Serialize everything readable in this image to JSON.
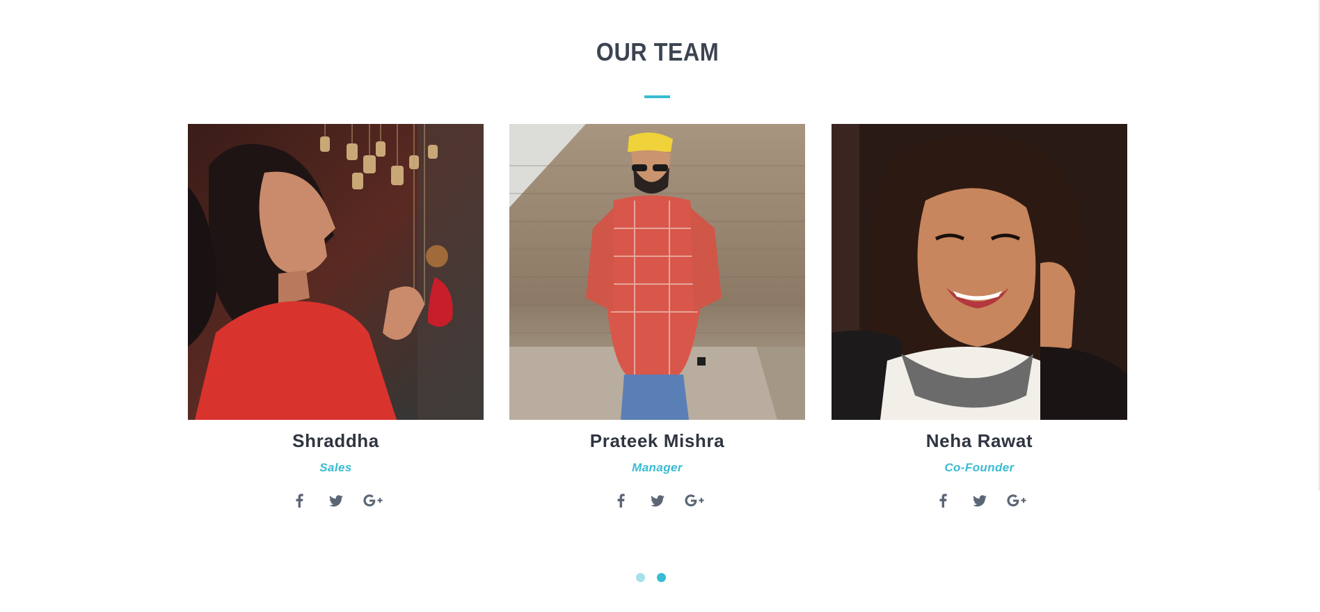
{
  "section": {
    "title": "OUR TEAM"
  },
  "colors": {
    "accent": "#38bcd2",
    "heading": "#3c4451",
    "name": "#2f3540",
    "icon": "#5b6675",
    "dot_inactive": "#a6e0ea",
    "dot_active": "#38bcd2"
  },
  "team": [
    {
      "name": "Shraddha",
      "role": "Sales",
      "photo": "woman-red-top-wind-chimes",
      "socials": [
        "facebook-icon",
        "twitter-icon",
        "google-plus-icon"
      ]
    },
    {
      "name": "Prateek Mishra",
      "role": "Manager",
      "photo": "man-yellow-cap-plaid-shirt",
      "socials": [
        "facebook-icon",
        "twitter-icon",
        "google-plus-icon"
      ]
    },
    {
      "name": "Neha Rawat",
      "role": "Co-Founder",
      "photo": "woman-smiling-necklace",
      "socials": [
        "facebook-icon",
        "twitter-icon",
        "google-plus-icon"
      ]
    }
  ],
  "carousel": {
    "pages": 2,
    "active_page": 2
  }
}
